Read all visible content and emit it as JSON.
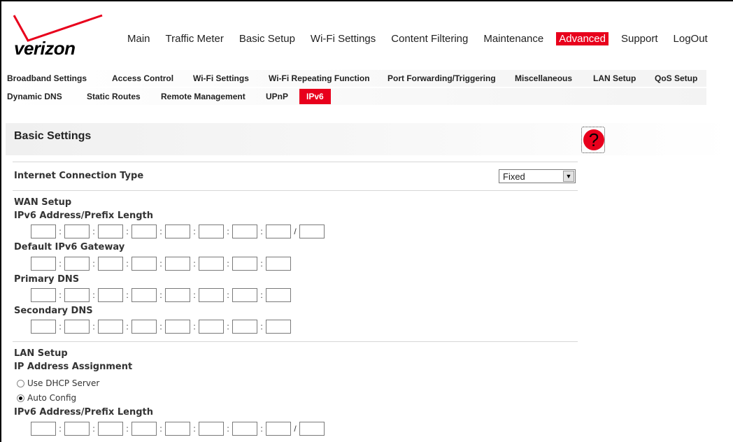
{
  "brand": {
    "logo_text": "verizon",
    "accent": "#e8001c"
  },
  "topnav": {
    "items": [
      "Main",
      "Traffic Meter",
      "Basic Setup",
      "Wi-Fi Settings",
      "Content Filtering",
      "Maintenance",
      "Advanced",
      "Support",
      "LogOut"
    ],
    "active": "Advanced"
  },
  "subnav": {
    "row1": [
      "Broadband Settings",
      "Access Control",
      "Wi-Fi Settings",
      "Wi-Fi Repeating Function",
      "Port Forwarding/Triggering",
      "Miscellaneous",
      "LAN Setup",
      "QoS Setup"
    ],
    "row2": [
      "Dynamic DNS",
      "Static Routes",
      "Remote Management",
      "UPnP",
      "IPv6"
    ],
    "active": "IPv6"
  },
  "page": {
    "title": "Basic Settings",
    "help_icon": "help-icon",
    "connection_type_label": "Internet Connection Type",
    "connection_type_value": "Fixed",
    "wan_setup": "WAN Setup",
    "ipv6_prefix_label": "IPv6 Address/Prefix Length",
    "gateway_label": "Default IPv6 Gateway",
    "primary_dns_label": "Primary DNS",
    "secondary_dns_label": "Secondary DNS",
    "lan_setup": "LAN Setup",
    "ip_assignment_label": "IP Address Assignment",
    "radio_dhcp": "Use DHCP Server",
    "radio_auto": "Auto Config",
    "lan_ipv6_prefix_label": "IPv6 Address/Prefix Length",
    "ip_separator": ":",
    "prefix_separator": "/"
  }
}
